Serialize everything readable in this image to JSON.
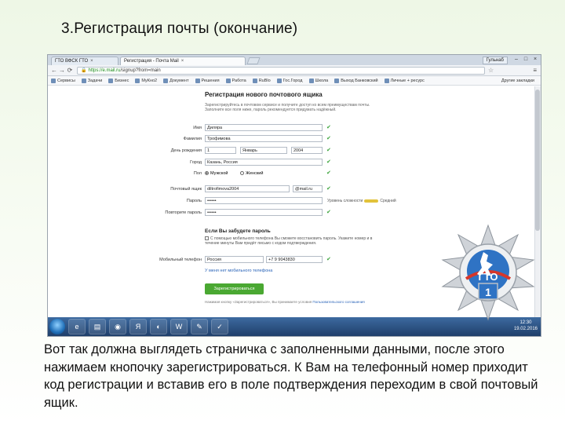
{
  "slide": {
    "title": "3.Регистрация почты  (окончание)",
    "caption": "Вот так должна выглядеть страничка с заполненными данными, после этого нажимаем кнопочку зарегистрироваться. К Вам на телефонный номер приходит код регистрации и вставив его в поле подтверждения переходим в свой почтовый ящик."
  },
  "browser": {
    "tabs": [
      {
        "label": "ГТО ВФСК ГТО",
        "active": false
      },
      {
        "label": "Регистрация - Почта Mail",
        "active": true
      }
    ],
    "user": "Гульнаб",
    "url_scheme": "https://",
    "url_host": "e.mail.ru",
    "url_path": "/signup?from=main",
    "bookmarks": [
      "Сервисы",
      "Задачи",
      "Бизнес",
      "МуКно2",
      "Документ",
      "Решения",
      "Работа",
      "RuBlo",
      "Гос.Город",
      "Школа",
      "Выход Банковский",
      "Личные + ресурс"
    ],
    "bookmarks_right": "Другие закладки"
  },
  "form": {
    "title": "Регистрация нового почтового ящика",
    "intro": "Зарегистрируйтесь в почтовом сервисе и получите доступ ко всем преимуществам почты. Заполните все поля ниже, пароль рекомендуется придумать надёжный.",
    "first_name_label": "Имя",
    "first_name": "Диляра",
    "last_name_label": "Фамилия",
    "last_name": "Трофимова",
    "birthdate_label": "День рождения",
    "birth_day": "1",
    "birth_month": "Январь",
    "birth_year": "2004",
    "city_label": "Город",
    "city": "Казань, Россия",
    "gender_label": "Пол",
    "gender_male": "Мужской",
    "gender_female": "Женский",
    "email_label": "Почтовый ящик",
    "email": "diltrofimova2004",
    "domain": "@mail.ru",
    "password_label": "Пароль",
    "password": "••••••",
    "strength_text": "Уровень сложности",
    "strength_value": "Средний",
    "password_confirm_label": "Повторите пароль",
    "password_confirm": "••••••",
    "recovery_title": "Если Вы забудете пароль",
    "recovery_note": "С помощью мобильного телефона Вы сможете восстановить пароль. Укажите номер и в течение минуты Вам придёт письмо с кодом подтверждения.",
    "phone_label": "Мобильный телефон",
    "phone_country": "Россия",
    "phone_number": "+7 9  9043830",
    "no_phone_link": "У меня нет мобильного телефона",
    "submit_label": "Зарегистрироваться",
    "terms_text": "Нажимая кнопку «Зарегистрироваться», Вы принимаете условия",
    "terms_link": "Пользовательского соглашения"
  },
  "taskbar": {
    "time": "12:30",
    "date": "19.02.2016"
  },
  "badge": {
    "text": "ГТО",
    "number": "1"
  },
  "colors": {
    "accent_green": "#4aa832",
    "link_blue": "#2a64b8",
    "check_green": "#3aa33a"
  }
}
